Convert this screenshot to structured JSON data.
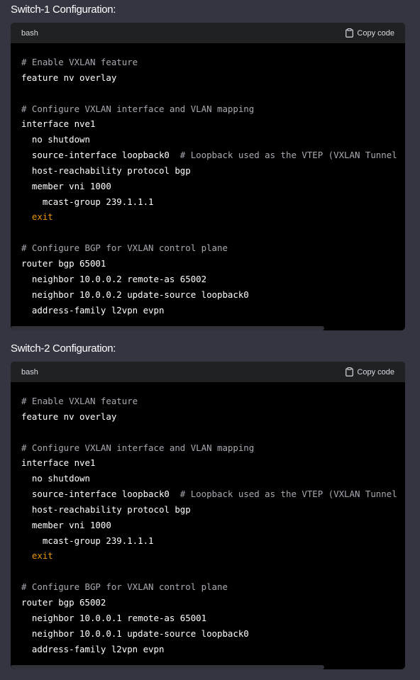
{
  "sections": [
    {
      "heading": "Switch-1 Configuration:",
      "language": "bash",
      "copy_label": "Copy code",
      "lines": [
        [
          {
            "t": "# Enable VXLAN feature",
            "c": "comment"
          }
        ],
        [
          {
            "t": "feature nv overlay",
            "c": "plain"
          }
        ],
        [],
        [
          {
            "t": "# Configure VXLAN interface and VLAN mapping",
            "c": "comment"
          }
        ],
        [
          {
            "t": "interface nve1",
            "c": "plain"
          }
        ],
        [
          {
            "t": "  no shutdown",
            "c": "plain"
          }
        ],
        [
          {
            "t": "  source-interface loopback0  ",
            "c": "plain"
          },
          {
            "t": "# Loopback used as the VTEP (VXLAN Tunnel",
            "c": "comment"
          }
        ],
        [
          {
            "t": "  host-reachability protocol bgp",
            "c": "plain"
          }
        ],
        [
          {
            "t": "  member vni 1000",
            "c": "plain"
          }
        ],
        [
          {
            "t": "    mcast-group 239.1.1.1",
            "c": "plain"
          }
        ],
        [
          {
            "t": "  ",
            "c": "plain"
          },
          {
            "t": "exit",
            "c": "keyword"
          }
        ],
        [],
        [
          {
            "t": "# Configure BGP for VXLAN control plane",
            "c": "comment"
          }
        ],
        [
          {
            "t": "router bgp 65001",
            "c": "plain"
          }
        ],
        [
          {
            "t": "  neighbor 10.0.0.2 remote-as 65002",
            "c": "plain"
          }
        ],
        [
          {
            "t": "  neighbor 10.0.0.2 update-source loopback0",
            "c": "plain"
          }
        ],
        [
          {
            "t": "  address-family l2vpn evpn",
            "c": "plain"
          }
        ]
      ]
    },
    {
      "heading": "Switch-2 Configuration:",
      "language": "bash",
      "copy_label": "Copy code",
      "lines": [
        [
          {
            "t": "# Enable VXLAN feature",
            "c": "comment"
          }
        ],
        [
          {
            "t": "feature nv overlay",
            "c": "plain"
          }
        ],
        [],
        [
          {
            "t": "# Configure VXLAN interface and VLAN mapping",
            "c": "comment"
          }
        ],
        [
          {
            "t": "interface nve1",
            "c": "plain"
          }
        ],
        [
          {
            "t": "  no shutdown",
            "c": "plain"
          }
        ],
        [
          {
            "t": "  source-interface loopback0  ",
            "c": "plain"
          },
          {
            "t": "# Loopback used as the VTEP (VXLAN Tunnel",
            "c": "comment"
          }
        ],
        [
          {
            "t": "  host-reachability protocol bgp",
            "c": "plain"
          }
        ],
        [
          {
            "t": "  member vni 1000",
            "c": "plain"
          }
        ],
        [
          {
            "t": "    mcast-group 239.1.1.1",
            "c": "plain"
          }
        ],
        [
          {
            "t": "  ",
            "c": "plain"
          },
          {
            "t": "exit",
            "c": "keyword"
          }
        ],
        [],
        [
          {
            "t": "# Configure BGP for VXLAN control plane",
            "c": "comment"
          }
        ],
        [
          {
            "t": "router bgp 65002",
            "c": "plain"
          }
        ],
        [
          {
            "t": "  neighbor 10.0.0.1 remote-as 65001",
            "c": "plain"
          }
        ],
        [
          {
            "t": "  neighbor 10.0.0.1 update-source loopback0",
            "c": "plain"
          }
        ],
        [
          {
            "t": "  address-family l2vpn evpn",
            "c": "plain"
          }
        ]
      ]
    }
  ],
  "colors": {
    "page_bg": "#343541",
    "code_bg": "#000000",
    "header_bg": "#202123",
    "comment": "#a9a9b3",
    "keyword": "#e9950c",
    "plain": "#ffffff"
  }
}
